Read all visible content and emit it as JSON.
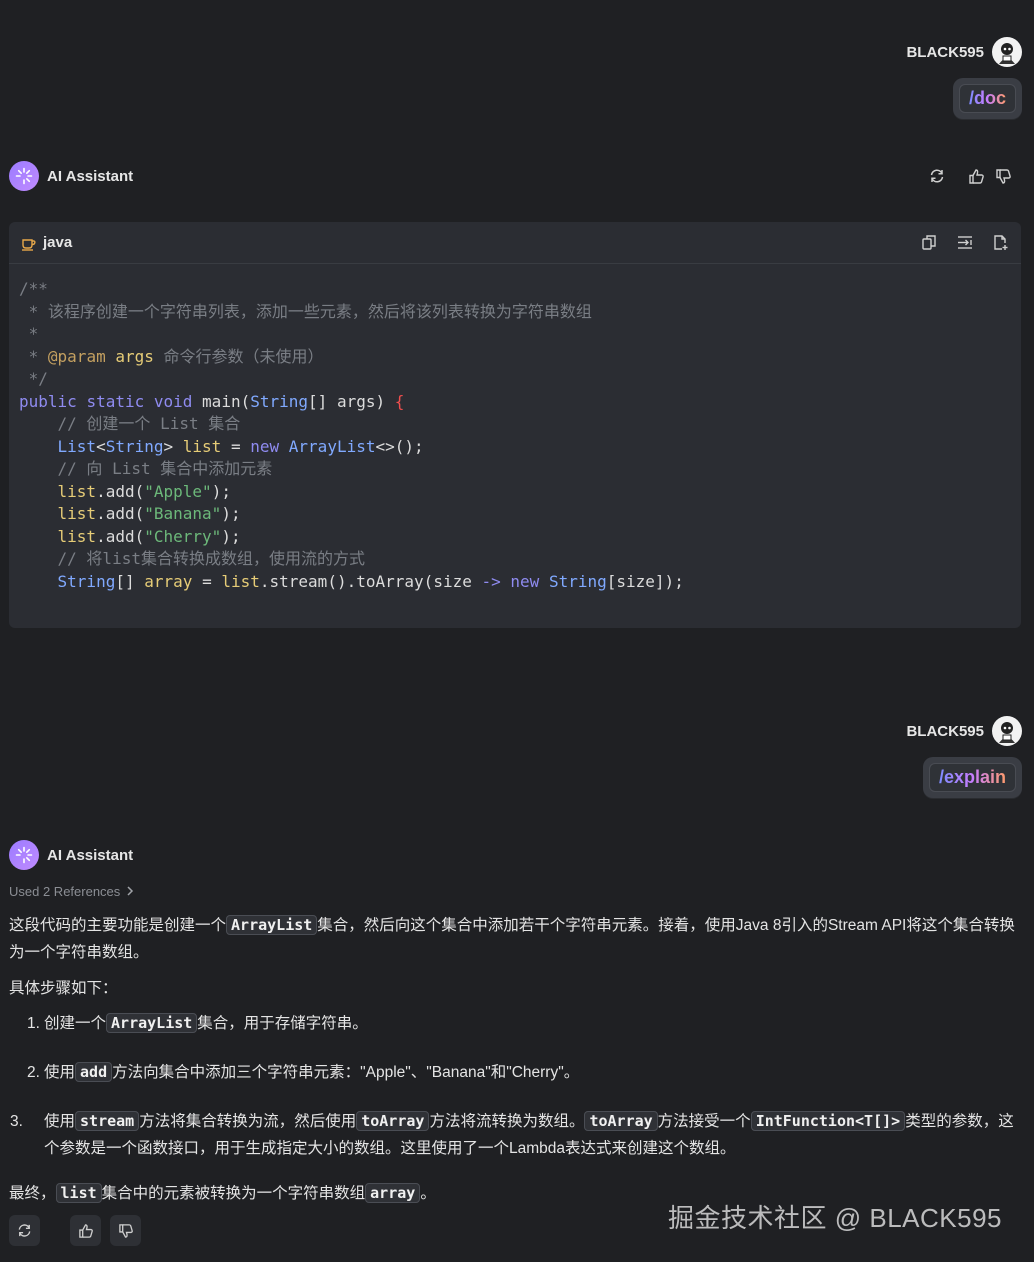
{
  "user": {
    "name": "BLACK595"
  },
  "messages": {
    "first_command": "/doc",
    "second_command": "/explain"
  },
  "assistant": {
    "name": "AI Assistant"
  },
  "code_block": {
    "language": "java",
    "lines": [
      "/**",
      " * 该程序创建一个字符串列表，添加一些元素，然后将该列表转换为字符串数组",
      " *",
      " * @param args 命令行参数（未使用）",
      " */",
      "public static void main(String[] args) {",
      "    // 创建一个 List 集合",
      "    List<String> list = new ArrayList<>();",
      "    // 向 List 集合中添加元素",
      "    list.add(\"Apple\");",
      "    list.add(\"Banana\");",
      "    list.add(\"Cherry\");",
      "    // 将list集合转换成数组，使用流的方式",
      "    String[] array = list.stream().toArray(size -> new String[size]);"
    ]
  },
  "explanation": {
    "references": "Used 2 References",
    "intro_a": "这段代码的主要功能是创建一个",
    "intro_code": "ArrayList",
    "intro_b": "集合，然后向这个集合中添加若干个字符串元素。接着，使用Java 8引入的Stream API将这个集合转换为一个字符串数组。",
    "steps_heading": "具体步骤如下：",
    "step1": {
      "num": "1.",
      "a": "创建一个",
      "code": "ArrayList",
      "b": "集合，用于存储字符串。"
    },
    "step2": {
      "num": "2.",
      "a": "使用",
      "code": "add",
      "b": "方法向集合中添加三个字符串元素：\"Apple\"、\"Banana\"和\"Cherry\"。"
    },
    "step3": {
      "num": "3.",
      "a": "使用",
      "code1": "stream",
      "b": "方法将集合转换为流，然后使用",
      "code2": "toArray",
      "c": "方法将流转换为数组。",
      "code3": "toArray",
      "d": "方法接受一个",
      "code4": "IntFunction<T[]>",
      "e": "类型的参数，这个参数是一个函数接口，用于生成指定大小的数组。这里使用了一个Lambda表达式来创建这个数组。"
    },
    "final_a": "最终，",
    "final_code1": "list",
    "final_b": "集合中的元素被转换为一个字符串数组",
    "final_code2": "array",
    "final_c": "。"
  },
  "watermark": "掘金技术社区 @ BLACK595",
  "icons": [
    "avatar",
    "regenerate-icon",
    "thumbs-up-icon",
    "thumbs-down-icon",
    "coffee-cup-icon",
    "copy-icon",
    "insert-icon",
    "new-file-icon",
    "chevron-right-icon"
  ]
}
